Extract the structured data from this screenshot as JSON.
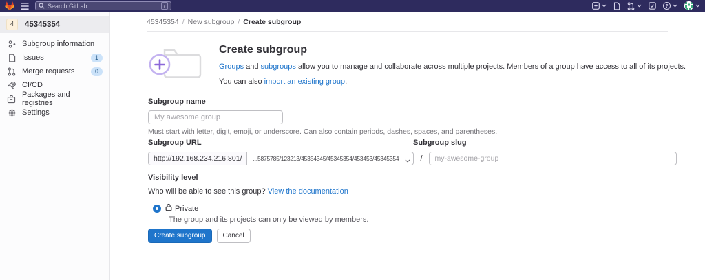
{
  "navbar": {
    "search_placeholder": "Search GitLab",
    "search_shortcut": "/",
    "icons": [
      {
        "name": "gitlab-logo-icon"
      },
      {
        "name": "hamburger-menu-icon"
      },
      {
        "name": "search-icon"
      },
      {
        "name": "new-menu-icon"
      },
      {
        "name": "issues-icon"
      },
      {
        "name": "merge-requests-icon"
      },
      {
        "name": "todo-list-icon"
      },
      {
        "name": "help-icon",
        "glyph": "?"
      },
      {
        "name": "avatar-identicon"
      }
    ]
  },
  "sidebar": {
    "group_avatar": "4",
    "group_name": "45345354",
    "items": [
      {
        "label": "Subgroup information",
        "icon": "subgroup-information-icon"
      },
      {
        "label": "Issues",
        "icon": "issues-icon",
        "badge": "1"
      },
      {
        "label": "Merge requests",
        "icon": "merge-request-icon",
        "badge": "0"
      },
      {
        "label": "CI/CD",
        "icon": "rocket-icon"
      },
      {
        "label": "Packages and registries",
        "icon": "package-icon"
      },
      {
        "label": "Settings",
        "icon": "gear-icon"
      }
    ]
  },
  "breadcrumb": {
    "separator": "/",
    "items": [
      "45345354",
      "New subgroup",
      "Create subgroup"
    ]
  },
  "header": {
    "title": "Create subgroup",
    "desc_link_groups": "Groups",
    "desc_and": " and ",
    "desc_link_subgroups": "subgroups",
    "desc_rest": " allow you to manage and collaborate across multiple projects. Members of a group have access to all of its projects.",
    "line2_pre": "You can also ",
    "line2_link": "import an existing group",
    "line2_post": "."
  },
  "form": {
    "name_label": "Subgroup name",
    "name_placeholder": "My awesome group",
    "name_help": "Must start with letter, digit, emoji, or underscore. Can also contain periods, dashes, spaces, and parentheses.",
    "url_label": "Subgroup URL",
    "slug_label": "Subgroup slug",
    "url_prefix": "http://192.168.234.216:801/",
    "url_selected": "...5875785/123213/45354345/45345354/453453/45345354",
    "path_separator": "/",
    "slug_placeholder": "my-awesome-group",
    "visibility_label": "Visibility level",
    "visibility_question": "Who will be able to see this group? ",
    "visibility_doc_link": "View the documentation",
    "private_label": "Private",
    "private_desc": "The group and its projects can only be viewed by members.",
    "submit_label": "Create subgroup",
    "cancel_label": "Cancel"
  },
  "colors": {
    "navbar_bg": "#2e2b5e",
    "link": "#1f75cb",
    "primary_button": "#1f75cb",
    "badge_bg": "#cbe2f9"
  }
}
